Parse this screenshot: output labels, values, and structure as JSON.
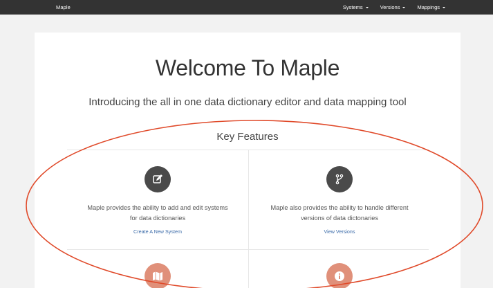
{
  "navbar": {
    "brand": "Maple",
    "menus": [
      {
        "label": "Systems"
      },
      {
        "label": "Versions"
      },
      {
        "label": "Mappings"
      }
    ]
  },
  "main": {
    "title": "Welcome To Maple",
    "subtitle": "Introducing the all in one data dictionary editor and data mapping tool",
    "key_features_title": "Key Features",
    "features": [
      {
        "icon": "edit-icon",
        "description": "Maple provides the ability to add and edit systems for data dictionaries",
        "link": "Create A New System"
      },
      {
        "icon": "branch-icon",
        "description": "Maple also provides the ability to handle different versions of data dictonaries",
        "link": "View Versions"
      },
      {
        "icon": "map-icon"
      },
      {
        "icon": "info-icon"
      }
    ]
  },
  "colors": {
    "navbar": "#333333",
    "icon_dark": "#4a4a4a",
    "icon_salmon": "#e0907a",
    "link": "#3a6aa8",
    "annotation": "#e04a2a"
  }
}
